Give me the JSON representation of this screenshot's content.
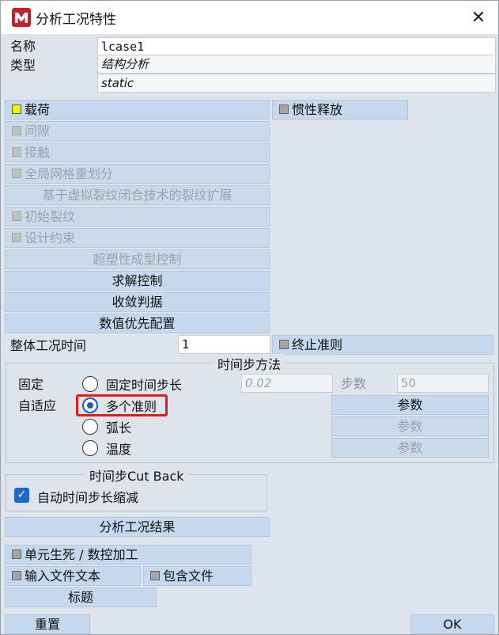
{
  "window": {
    "title": "分析工况特性",
    "logo_icon": "midas-logo-icon",
    "close_icon": "close-icon"
  },
  "header": {
    "name_label": "名称",
    "name_value": "lcase1",
    "type_label": "类型",
    "type_value": "结构分析",
    "subtype_value": "static"
  },
  "buttons": {
    "load": "载荷",
    "inertia_relief": "惯性释放",
    "gap": "间隙",
    "contact": "接触",
    "global_remesh": "全局网格重划分",
    "vcct": "基于虚拟裂纹闭合技术的裂纹扩展",
    "initial_crack": "初始裂纹",
    "design_constraint": "设计约束",
    "superplastic": "超塑性成型控制",
    "solution_control": "求解控制",
    "convergence": "收敛判据",
    "numeric_priority": "数值优先配置"
  },
  "total_time": {
    "label": "整体工况时间",
    "value": "1",
    "stop_criteria": "终止准则"
  },
  "time_step": {
    "group_title": "时间步方法",
    "fixed_label": "固定",
    "adaptive_label": "自适应",
    "options": [
      {
        "label": "固定时间步长",
        "selected": false
      },
      {
        "label": "多个准则",
        "selected": true
      },
      {
        "label": "弧长",
        "selected": false
      },
      {
        "label": "温度",
        "selected": false
      }
    ],
    "fixed_step_value": "0.02",
    "steps_label": "步数",
    "steps_value": "50",
    "params_label": "参数"
  },
  "cutback": {
    "group_title": "时间步Cut Back",
    "auto_reduce_label": "自动时间步长缩减",
    "checked": true
  },
  "results_button": "分析工况结果",
  "bottom": {
    "element_birth": "单元生死 / 数控加工",
    "input_text": "输入文件文本",
    "include_file": "包含文件",
    "title": "标题",
    "reset": "重置",
    "ok": "OK"
  },
  "colors": {
    "accent": "#1560bd",
    "button_bg": "#c5d8ee",
    "window_bg": "#dde4ec",
    "highlight": "#e21b1b",
    "load_marker": "#f2f200"
  }
}
